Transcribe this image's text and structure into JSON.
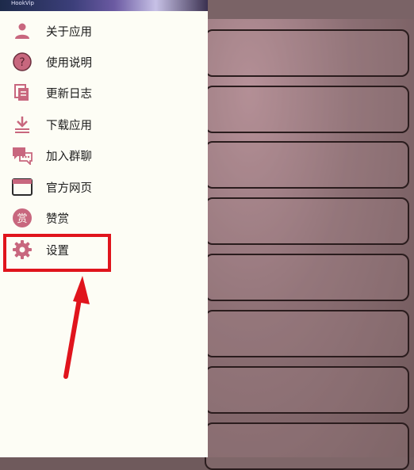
{
  "header": {
    "brand_text": "HookVip"
  },
  "menu": {
    "items": [
      {
        "label": "关于应用",
        "icon": "person-icon"
      },
      {
        "label": "使用说明",
        "icon": "help-circle-icon"
      },
      {
        "label": "更新日志",
        "icon": "document-copy-icon"
      },
      {
        "label": "下载应用",
        "icon": "download-icon"
      },
      {
        "label": "加入群聊",
        "icon": "chat-group-icon"
      },
      {
        "label": "官方网页",
        "icon": "browser-window-icon"
      },
      {
        "label": "赞赏",
        "icon": "reward-badge-icon"
      },
      {
        "label": "设置",
        "icon": "gear-settings-icon"
      }
    ]
  },
  "colors": {
    "icon_accent": "#c8677e",
    "drawer_bg": "#fdfdf5",
    "annotation_red": "#e0141c"
  },
  "icon_glyphs": {
    "help": "?",
    "reward": "赏"
  }
}
